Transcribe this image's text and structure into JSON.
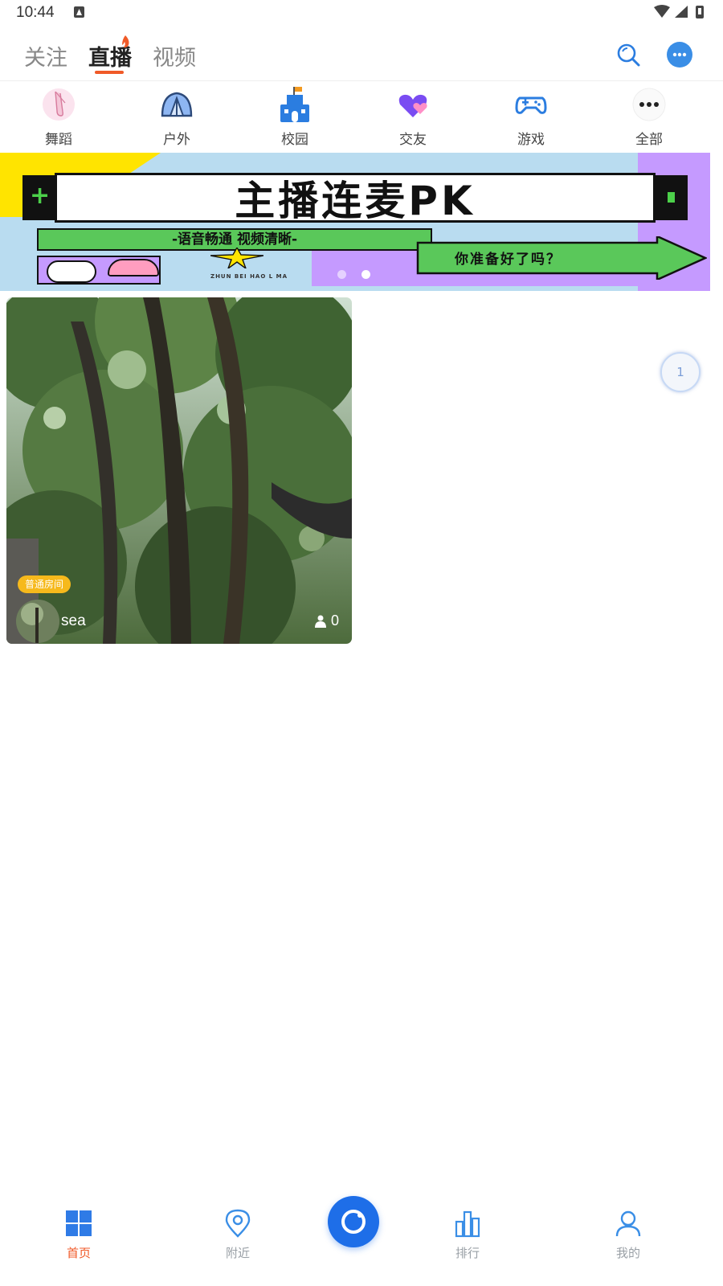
{
  "status_bar": {
    "time": "10:44"
  },
  "top_tabs": [
    {
      "label": "关注"
    },
    {
      "label": "直播",
      "active": true
    },
    {
      "label": "视频"
    }
  ],
  "categories": [
    {
      "label": "舞蹈",
      "icon": "ballet-shoe-icon"
    },
    {
      "label": "户外",
      "icon": "tent-icon"
    },
    {
      "label": "校园",
      "icon": "school-icon"
    },
    {
      "label": "交友",
      "icon": "hearts-icon"
    },
    {
      "label": "游戏",
      "icon": "gamepad-icon"
    },
    {
      "label": "全部",
      "icon": "more-dots-icon"
    }
  ],
  "banner": {
    "title": "主播连麦PK",
    "subtitle": "-语音畅通 视频清晰-",
    "arrow_text": "你准备好了吗？",
    "small_text": "ZHUN BEI HAO L MA",
    "slide_count": 2,
    "active_slide": 2
  },
  "live_card": {
    "room_tag": "普通房间",
    "username": "sea",
    "viewer_count": "0"
  },
  "page_float": {
    "label": "1"
  },
  "bottom_nav": [
    {
      "label": "首页",
      "icon": "home-grid-icon",
      "active": true
    },
    {
      "label": "附近",
      "icon": "location-pin-icon"
    },
    {
      "label": "排行",
      "icon": "ranking-bars-icon"
    },
    {
      "label": "我的",
      "icon": "profile-icon"
    }
  ],
  "colors": {
    "accent": "#f05a28",
    "primary_blue": "#1e6ee8",
    "icon_blue": "#3a8ee6",
    "room_tag": "#f6b91c"
  }
}
